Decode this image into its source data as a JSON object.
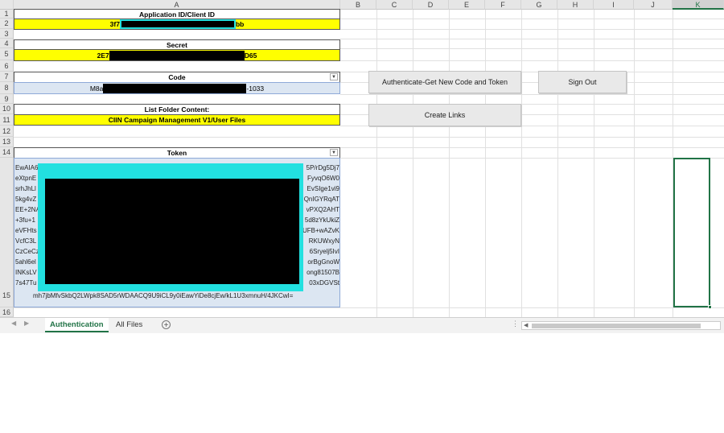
{
  "columns": [
    "A",
    "B",
    "C",
    "D",
    "E",
    "F",
    "G",
    "H",
    "I",
    "J",
    "K"
  ],
  "rows": [
    "1",
    "2",
    "3",
    "4",
    "5",
    "6",
    "7",
    "8",
    "9",
    "10",
    "11",
    "12",
    "13",
    "14",
    "15",
    "16"
  ],
  "cells": {
    "app_id_header": "Application ID/Client ID",
    "app_id_prefix": "3f7",
    "app_id_suffix": "bb",
    "secret_header": "Secret",
    "secret_prefix": "2E7",
    "secret_suffix": "D65",
    "code_header": "Code",
    "code_prefix": "M8a",
    "code_suffix": "-1033",
    "folder_header": "List Folder Content:",
    "folder_value": "CIIN Campaign Management V1/User Files",
    "token_header": "Token"
  },
  "token_left": [
    "EwAIA6",
    "eXtpnE",
    "srhJhLl",
    "5kg4vZ",
    "EE+2NA",
    "+3fu+1",
    "eVFHts",
    "VcfC3L",
    "CzCeCz",
    "5ahl6el",
    "INKsLV",
    "7s47Tu"
  ],
  "token_right": [
    "5P/rDg5Dj7",
    "FyvqO6W0",
    "EvSIge1vi9",
    "QnIGYRqAT",
    "vPXQ2AHT",
    "5d8zYkUkiZ",
    "UFB+wAZvK",
    "RKUWxyN",
    "6Sryelj5IvI",
    "orBgGnoW",
    "ong81507B",
    "03xDGVSt"
  ],
  "token_last_line": "mh7jbMfvSkbQ2LWpk8SAD5rWDAACQ9U9iCL9y0iEawYiDe8cjEw/kL1U3xmnuH/4JKCwI=",
  "buttons": {
    "authenticate": "Authenticate-Get New Code and Token",
    "sign_out": "Sign Out",
    "create_links": "Create Links"
  },
  "tabs": [
    "Authentication",
    "All Files"
  ],
  "active_tab": "Authentication",
  "colors": {
    "yellow": "#ffff00",
    "highlight_cyan": "#22e0e0",
    "selection_green": "#217346"
  }
}
